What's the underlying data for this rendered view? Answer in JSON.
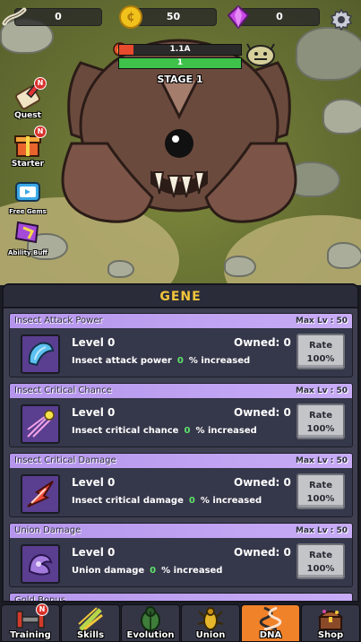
{
  "topbar": {
    "bones": "0",
    "gold": "50",
    "gems": "0"
  },
  "boss": {
    "hp_text": "1.1A",
    "hp_fraction": 0.12,
    "shield_text": "1",
    "shield_fraction": 1.0,
    "stage": "STAGE 1"
  },
  "side_menu": [
    {
      "label": "Quest",
      "badge": "N",
      "icon": "quest-scroll-icon"
    },
    {
      "label": "Starter",
      "badge": "N",
      "icon": "starter-gift-icon"
    },
    {
      "label": "Free Gems",
      "badge": "",
      "icon": "tv-ad-icon"
    },
    {
      "label": "Ability Buff",
      "badge": "",
      "icon": "ability-buff-icon"
    }
  ],
  "panel": {
    "title": "GENE",
    "cards": [
      {
        "name": "Insect Attack Power",
        "max": "Max Lv : 50",
        "level": "Level 0",
        "owned": "Owned: 0",
        "desc_pre": "Insect attack power",
        "value": "0",
        "desc_post": "% increased",
        "rate_label": "Rate",
        "rate_value": "100%",
        "icon": "claw-icon",
        "icon_color": "#5cc1f0"
      },
      {
        "name": "Insect Critical Chance",
        "max": "Max Lv : 50",
        "level": "Level 0",
        "owned": "Owned: 0",
        "desc_pre": "Insect critical chance",
        "value": "0",
        "desc_post": "% increased",
        "rate_label": "Rate",
        "rate_value": "100%",
        "icon": "critical-chance-icon",
        "icon_color": "#f3a3e6"
      },
      {
        "name": "Insect Critical Damage",
        "max": "Max Lv : 50",
        "level": "Level 0",
        "owned": "Owned: 0",
        "desc_pre": "Insect critical damage",
        "value": "0",
        "desc_post": "% increased",
        "rate_label": "Rate",
        "rate_value": "100%",
        "icon": "critical-damage-icon",
        "icon_color": "#f04a3a"
      },
      {
        "name": "Union Damage",
        "max": "Max Lv : 50",
        "level": "Level 0",
        "owned": "Owned: 0",
        "desc_pre": "Union damage",
        "value": "0",
        "desc_post": "% increased",
        "rate_label": "Rate",
        "rate_value": "100%",
        "icon": "union-damage-icon",
        "icon_color": "#a27bdc"
      }
    ],
    "partial_card": "Gold Bonus"
  },
  "tabs": [
    {
      "label": "Training",
      "badge": "N",
      "icon": "training-icon",
      "active": false
    },
    {
      "label": "Skills",
      "badge": "",
      "icon": "skills-icon",
      "active": false
    },
    {
      "label": "Evolution",
      "badge": "",
      "icon": "evolution-icon",
      "active": false
    },
    {
      "label": "Union",
      "badge": "",
      "icon": "union-icon",
      "active": false
    },
    {
      "label": "DNA",
      "badge": "",
      "icon": "dna-icon",
      "active": true
    },
    {
      "label": "Shop",
      "badge": "",
      "icon": "shop-chest-icon",
      "active": false
    }
  ],
  "colors": {
    "hp_red": "#e74a2c",
    "shield_green": "#3ec24a",
    "accent_gold": "#f3c63a",
    "card_header": "#b596ec",
    "active_tab": "#f0822a"
  }
}
